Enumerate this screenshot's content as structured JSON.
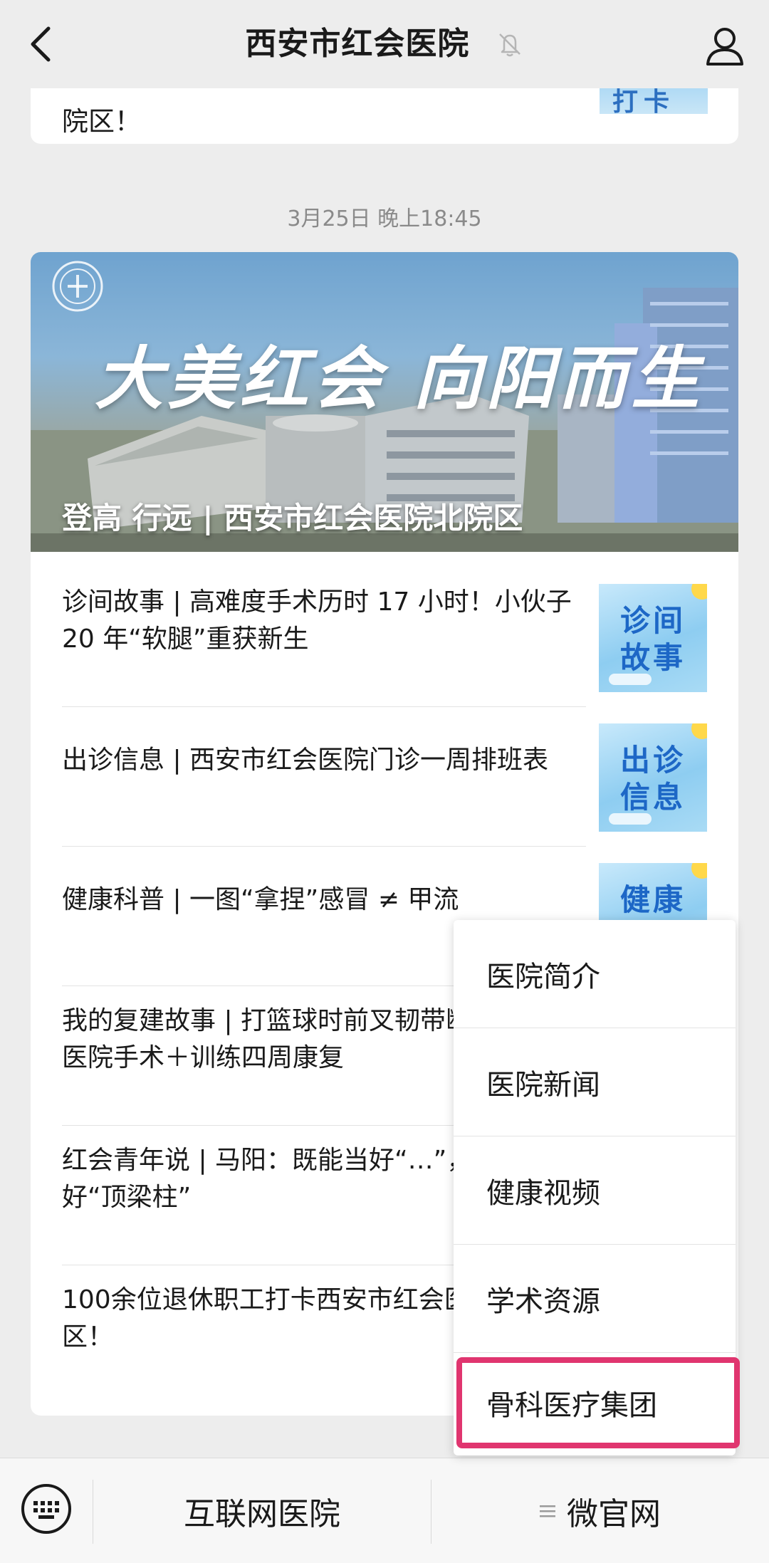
{
  "header": {
    "title": "西安市红会医院"
  },
  "prev_card": {
    "text": "院区！",
    "thumb_text": "打卡"
  },
  "timestamp": "3月25日 晚上18:45",
  "banner": {
    "hero_text": "大美红会 向阳而生",
    "caption": "登高 行远 | 西安市红会医院北院区"
  },
  "articles": [
    {
      "title": "诊间故事 | 高难度手术历时 17 小时！小伙子 20 年“软腿”重获新生",
      "thumb": "诊间故事"
    },
    {
      "title": "出诊信息 | 西安市红会医院门诊一周排班表",
      "thumb": "出诊信息"
    },
    {
      "title": "健康科普 | 一图“拿捏”感冒 ≠ 甲流",
      "thumb": "健康"
    },
    {
      "title": "我的复建故事 | 打篮球时前叉韧带断裂，红会医院手术＋训练四周康复",
      "thumb": ""
    },
    {
      "title": "红会青年说 | 马阳：既能当好“…”，也可做好“顶梁柱”",
      "thumb": ""
    },
    {
      "title": "100余位退休职工打卡西安市红会医院北院区！",
      "thumb": ""
    }
  ],
  "menu": {
    "items": [
      "医院简介",
      "医院新闻",
      "健康视频",
      "学术资源",
      "骨科医疗集团"
    ]
  },
  "bottom_bar": {
    "tab_hospital": "互联网医院",
    "tab_official": "微官网"
  },
  "colors": {
    "background": "#ededed",
    "highlight": "#e0356f",
    "thumb_text": "#1d67c6"
  }
}
